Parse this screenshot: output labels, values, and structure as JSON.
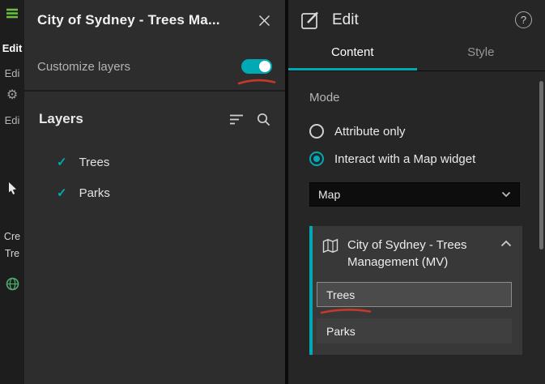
{
  "colors": {
    "accent": "#00aab5",
    "annotation": "#c4392c"
  },
  "icons": {
    "check": "✓",
    "help": "?"
  },
  "left_rail": {
    "items": [
      "Edit",
      "Edi",
      "Edi",
      "Cre",
      "Tre"
    ]
  },
  "layers_panel": {
    "title": "City of Sydney - Trees Ma...",
    "customize_toggle": {
      "label": "Customize layers",
      "on": true
    },
    "heading": "Layers",
    "layers": [
      {
        "name": "Trees"
      },
      {
        "name": "Parks"
      }
    ]
  },
  "edit_panel": {
    "title": "Edit",
    "tabs": [
      {
        "label": "Content",
        "active": true
      },
      {
        "label": "Style",
        "active": false
      }
    ],
    "mode": {
      "heading": "Mode",
      "options": [
        {
          "label": "Attribute only",
          "selected": false
        },
        {
          "label": "Interact with a Map widget",
          "selected": true
        }
      ]
    },
    "map_dropdown": {
      "value": "Map"
    },
    "map_source": {
      "title": "City of Sydney - Trees Management (MV)",
      "expanded": true,
      "layers": [
        {
          "name": "Trees",
          "selected": true
        },
        {
          "name": "Parks",
          "selected": false
        }
      ]
    }
  }
}
